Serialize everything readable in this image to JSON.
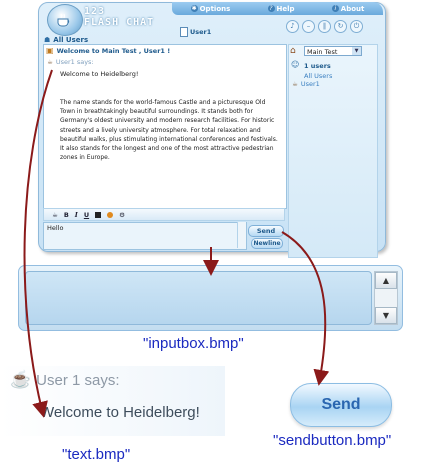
{
  "app": {
    "logo_line1": "123",
    "logo_line2": "FLASH CHAT",
    "menu": [
      {
        "label": "Options",
        "icon": "options-icon"
      },
      {
        "label": "Help",
        "icon": "help-icon"
      },
      {
        "label": "About",
        "icon": "about-icon"
      }
    ],
    "current_user": "User1",
    "tab_label": "All Users"
  },
  "chat": {
    "room_header": "Welcome to Main Test , User1 !",
    "sender_line": "User1 says:",
    "first_message": "Welcome to Heidelberg!",
    "description": "The name stands for the world-famous Castle and a picturesque Old Town in breathtakingly beautiful surroundings. It stands both for Germany's oldest university and modern research facilities. For historic streets and a lively university atmosphere. For total relaxation and beautiful walks, plus stimulating international conferences and festivals. It also stands for the longest and one of the most attractive pedestrian zones in Europe."
  },
  "sidebar": {
    "room_select": "Main Test",
    "user_count": "1 users",
    "all_users": "All Users",
    "users": [
      "User1"
    ]
  },
  "toolbar": {
    "bold": "B",
    "italic": "I",
    "underline": "U"
  },
  "input": {
    "value": "Hello",
    "send_label": "Send",
    "newline_label": "Newline"
  },
  "callouts": {
    "inputbox_caption": "\"inputbox.bmp\"",
    "text_caption": "\"text.bmp\"",
    "sendbutton_caption": "\"sendbutton.bmp\"",
    "big_says": "User 1 says:",
    "big_message": "Welcome to Heidelberg!",
    "big_send": "Send"
  },
  "colors": {
    "accent": "#6aa9dc",
    "caption": "#1b2ac0",
    "arrow": "#8b1a1a"
  }
}
